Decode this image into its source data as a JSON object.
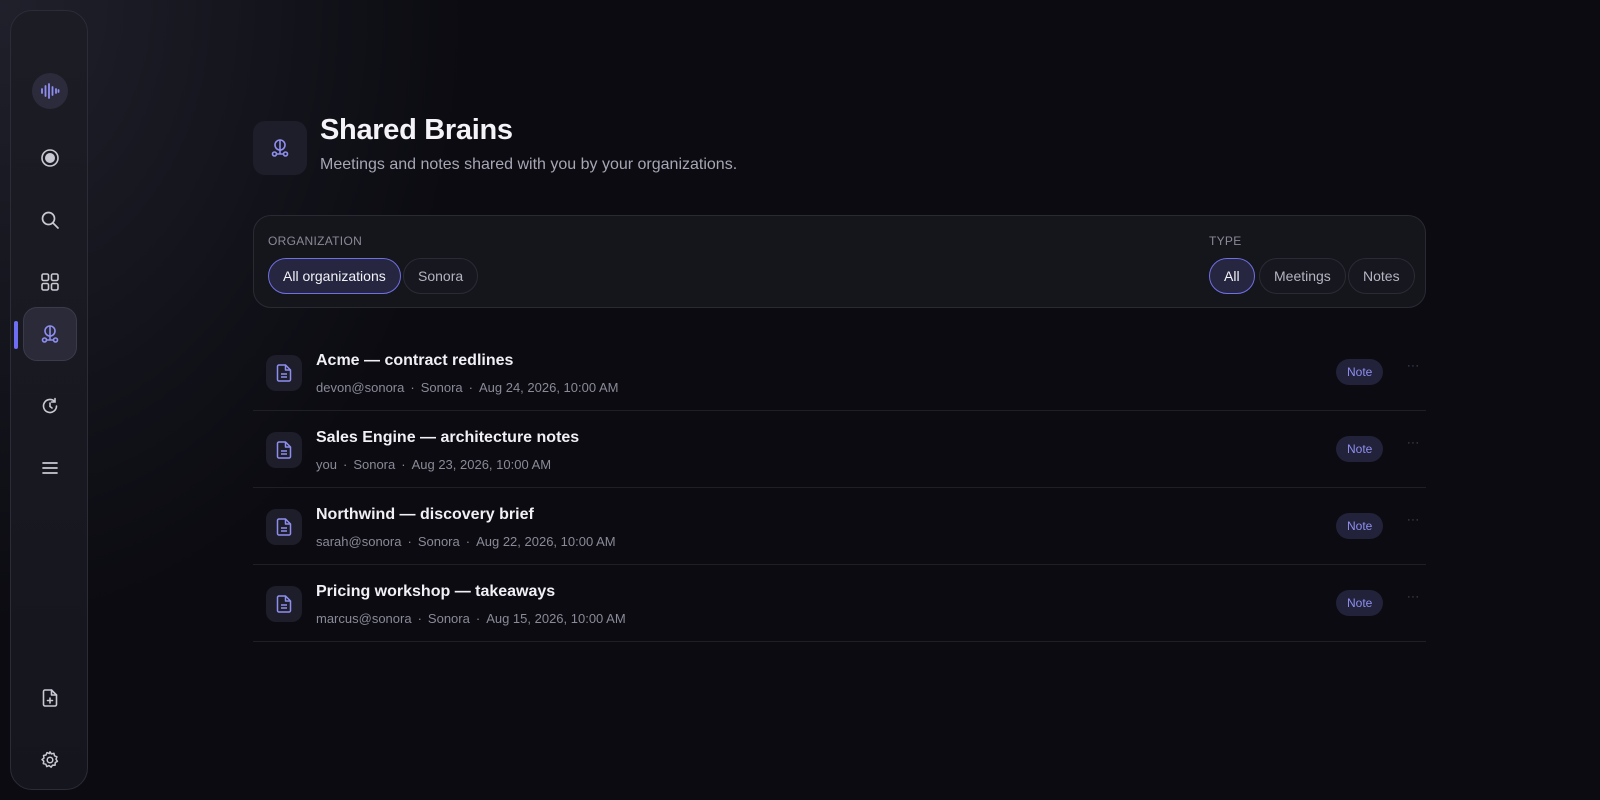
{
  "sidebar": {
    "items": [
      {
        "icon": "audio-wave-icon"
      },
      {
        "icon": "record-icon"
      },
      {
        "icon": "search-icon"
      },
      {
        "icon": "grid-icon"
      },
      {
        "icon": "shared-brains-icon",
        "active": true
      },
      {
        "icon": "refresh-icon"
      },
      {
        "icon": "menu-icon"
      },
      {
        "icon": "new-file-icon"
      },
      {
        "icon": "settings-icon"
      }
    ]
  },
  "header": {
    "title": "Shared Brains",
    "subtitle": "Meetings and notes shared with you by your organizations."
  },
  "filters": {
    "organization_label": "ORGANIZATION",
    "organizations": [
      {
        "label": "All organizations",
        "selected": true
      },
      {
        "label": "Sonora",
        "selected": false
      }
    ],
    "type_label": "TYPE",
    "types": [
      {
        "label": "All",
        "selected": true
      },
      {
        "label": "Meetings",
        "selected": false
      },
      {
        "label": "Notes",
        "selected": false
      }
    ]
  },
  "items": [
    {
      "title": "Acme — contract redlines",
      "author": "devon@sonora",
      "org": "Sonora",
      "date": "Aug 24, 2026, 10:00 AM",
      "badge": "Note",
      "more": "···"
    },
    {
      "title": "Sales Engine — architecture notes",
      "author": "you",
      "org": "Sonora",
      "date": "Aug 23, 2026, 10:00 AM",
      "badge": "Note",
      "more": "···"
    },
    {
      "title": "Northwind — discovery brief",
      "author": "sarah@sonora",
      "org": "Sonora",
      "date": "Aug 22, 2026, 10:00 AM",
      "badge": "Note",
      "more": "···"
    },
    {
      "title": "Pricing workshop — takeaways",
      "author": "marcus@sonora",
      "org": "Sonora",
      "date": "Aug 15, 2026, 10:00 AM",
      "badge": "Note",
      "more": "···"
    }
  ],
  "colors": {
    "accent": "#6e6ef5",
    "background": "#0b0b11",
    "badge_text": "#8e8ef0"
  }
}
